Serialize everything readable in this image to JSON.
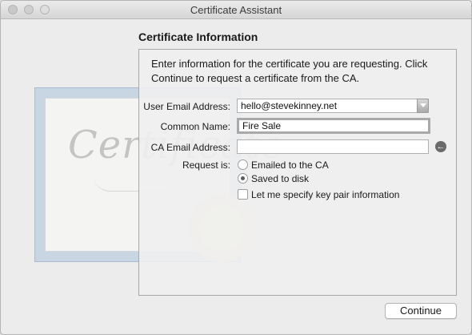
{
  "window": {
    "title": "Certificate Assistant"
  },
  "section": {
    "title": "Certificate Information",
    "intro": "Enter information for the certificate you are requesting. Click Continue to request a certificate from the CA."
  },
  "form": {
    "user_email": {
      "label": "User Email Address:",
      "value": "hello@stevekinney.net"
    },
    "common_name": {
      "label": "Common Name:",
      "value": "Fire Sale"
    },
    "ca_email": {
      "label": "CA Email Address:",
      "value": ""
    },
    "request_is": {
      "label": "Request is:",
      "options": [
        {
          "label": "Emailed to the CA",
          "selected": false
        },
        {
          "label": "Saved to disk",
          "selected": true
        }
      ]
    },
    "key_pair_checkbox": {
      "label": "Let me specify key pair information",
      "checked": false
    }
  },
  "buttons": {
    "continue": "Continue"
  },
  "illustration": {
    "text": "Certificate"
  },
  "icons": {
    "close": "close-icon",
    "minimize": "minimize-icon",
    "zoom": "zoom-icon",
    "dropdown": "chevron-down-icon",
    "back_arrow": "arrow-left-icon"
  }
}
